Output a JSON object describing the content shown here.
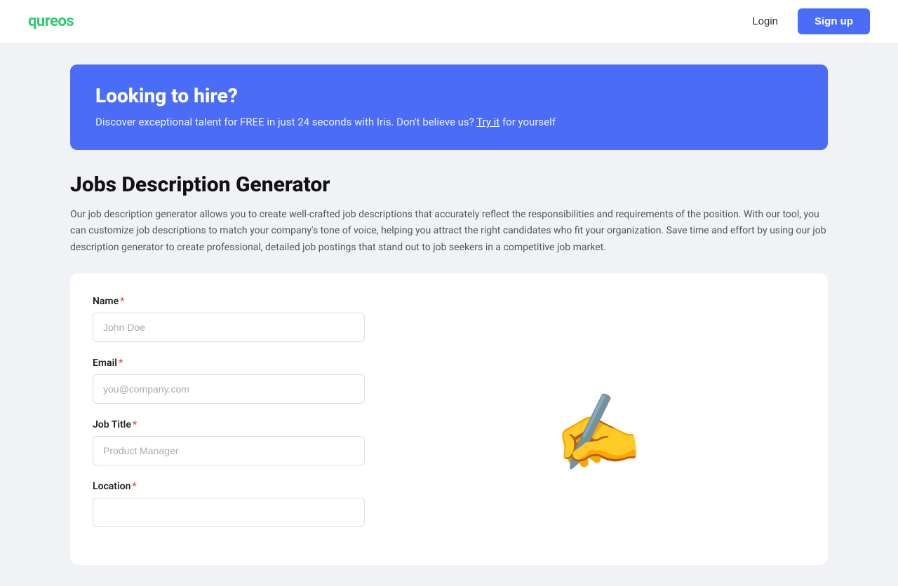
{
  "header": {
    "logo": "qureos",
    "login_label": "Login",
    "signup_label": "Sign up"
  },
  "banner": {
    "title": "Looking to hire?",
    "subtitle_pre": "Discover exceptional talent for FREE in just 24 seconds with Iris. Don't believe us?",
    "link_text": "Try it",
    "subtitle_post": "for yourself"
  },
  "section": {
    "title": "Jobs Description Generator",
    "description": "Our job description generator allows you to create well-crafted job descriptions that accurately reflect the responsibilities and requirements of the position. With our tool, you can customize job descriptions to match your company's tone of voice, helping you attract the right candidates who fit your organization. Save time and effort by using our job description generator to create professional, detailed job postings that stand out to job seekers in a competitive job market."
  },
  "form": {
    "name_label": "Name",
    "name_placeholder": "John Doe",
    "email_label": "Email",
    "email_placeholder": "you@company.com",
    "job_title_label": "Job Title",
    "job_title_value": "Product Manager",
    "location_label": "Location"
  }
}
